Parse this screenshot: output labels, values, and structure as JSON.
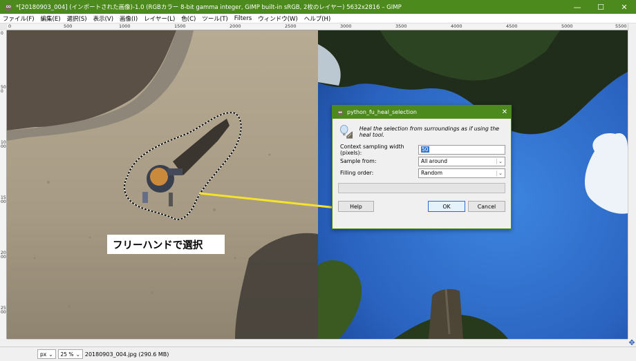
{
  "window": {
    "title": "*[20180903_004] (インポートされた画像)-1.0 (RGBカラー 8-bit gamma integer, GIMP built-in sRGB, 2枚のレイヤー) 5632x2816 – GIMP",
    "minimize": "—",
    "maximize": "☐",
    "close": "✕"
  },
  "menu": [
    "ファイル(F)",
    "編集(E)",
    "選択(S)",
    "表示(V)",
    "画像(I)",
    "レイヤー(L)",
    "色(C)",
    "ツール(T)",
    "Filters",
    "ウィンドウ(W)",
    "ヘルプ(H)"
  ],
  "ruler": {
    "top_labels": [
      "0",
      "500",
      "1000",
      "1500",
      "2000",
      "2500",
      "3000",
      "3500",
      "4000",
      "4500",
      "5000",
      "5500"
    ],
    "left_labels": [
      "0",
      "500",
      "1000",
      "1500",
      "2000",
      "2500"
    ]
  },
  "annotation": {
    "label": "フリーハンドで選択"
  },
  "dialog": {
    "title": "python_fu_heal_selection",
    "close": "✕",
    "description": "Heal the selection from surroundings as if using the heal tool.",
    "fields": {
      "context_label": "Context sampling width (pixels):",
      "context_value": "50",
      "sample_label": "Sample from:",
      "sample_value": "All around",
      "order_label": "Filling order:",
      "order_value": "Random"
    },
    "buttons": {
      "help": "Help",
      "ok": "OK",
      "cancel": "Cancel"
    },
    "progress": 0
  },
  "status": {
    "unit": "px",
    "zoom": "25 %",
    "file_info": "20180903_004.jpg (290.6 MB)"
  },
  "colors": {
    "titlebar": "#4d8a1d",
    "highlight": "#f5e22a",
    "sky": "#2c6bc4"
  }
}
